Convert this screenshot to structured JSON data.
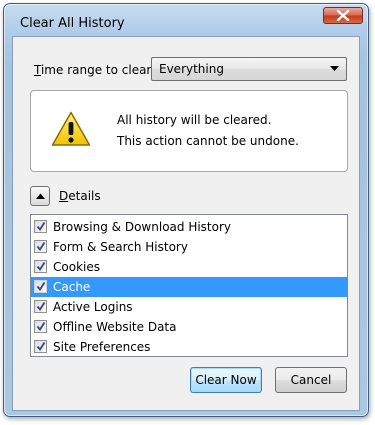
{
  "window": {
    "title": "Clear All History"
  },
  "time_range": {
    "label": "Time range to clear:",
    "access_key": "T",
    "label_rest": "ime range to clear:",
    "selected": "Everything"
  },
  "warning": {
    "line1": "All history will be cleared.",
    "line2": "This action cannot be undone."
  },
  "details": {
    "label": "Details",
    "access_key": "D",
    "label_rest": "etails",
    "expanded": true
  },
  "items": [
    {
      "label": "Browsing & Download History",
      "checked": true,
      "selected": false
    },
    {
      "label": "Form & Search History",
      "checked": true,
      "selected": false
    },
    {
      "label": "Cookies",
      "checked": true,
      "selected": false
    },
    {
      "label": "Cache",
      "checked": true,
      "selected": true
    },
    {
      "label": "Active Logins",
      "checked": true,
      "selected": false
    },
    {
      "label": "Offline Website Data",
      "checked": true,
      "selected": false
    },
    {
      "label": "Site Preferences",
      "checked": true,
      "selected": false
    }
  ],
  "buttons": {
    "clear_now": "Clear Now",
    "cancel": "Cancel"
  },
  "colors": {
    "selection": "#3399ff",
    "close_button": "#c33a1e",
    "warning_yellow": "#f5d000"
  }
}
